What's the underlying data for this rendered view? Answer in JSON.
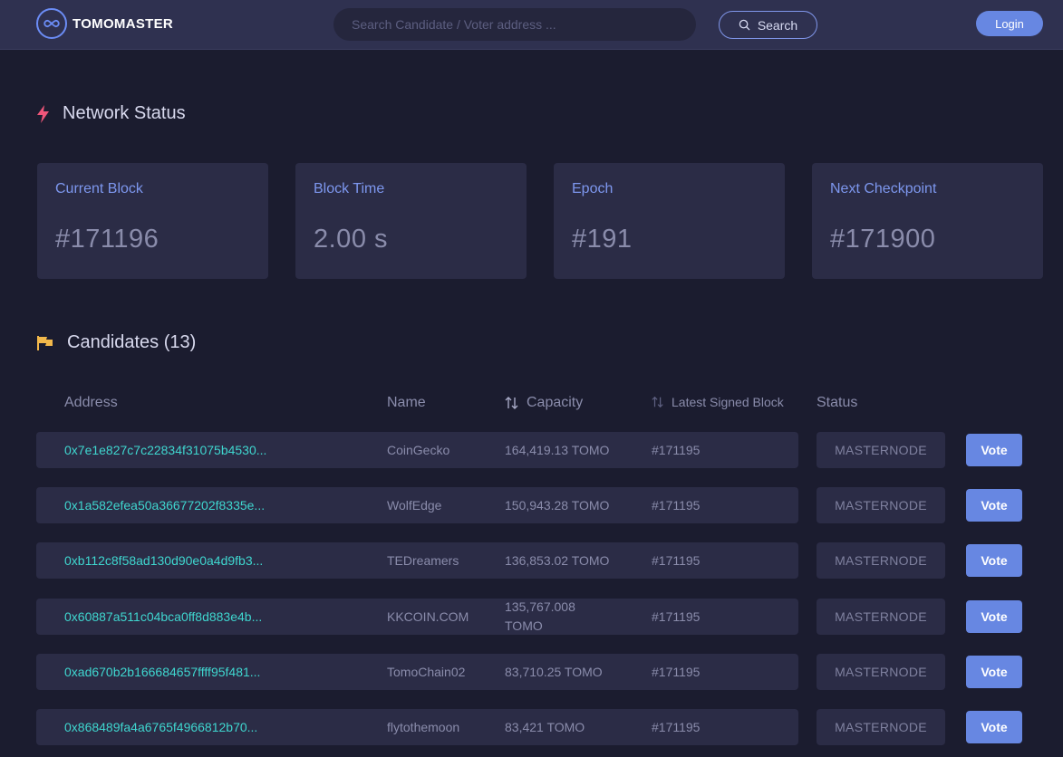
{
  "header": {
    "logo_text": "TOMOMASTER",
    "search_placeholder": "Search Candidate / Voter address ...",
    "search_label": "Search",
    "login_label": "Login"
  },
  "network_status": {
    "title": "Network Status",
    "cards": [
      {
        "label": "Current Block",
        "value": "#171196"
      },
      {
        "label": "Block Time",
        "value": "2.00 s"
      },
      {
        "label": "Epoch",
        "value": "#191"
      },
      {
        "label": "Next Checkpoint",
        "value": "#171900"
      }
    ]
  },
  "candidates": {
    "title": "Candidates (13)",
    "columns": {
      "address": "Address",
      "name": "Name",
      "capacity": "Capacity",
      "latest_signed_block": "Latest Signed Block",
      "status": "Status"
    },
    "vote_label": "Vote",
    "rows": [
      {
        "address": "0x7e1e827c7c22834f31075b4530...",
        "name": "CoinGecko",
        "capacity": "164,419.13 TOMO",
        "block": "#171195",
        "status": "MASTERNODE"
      },
      {
        "address": "0x1a582efea50a36677202f8335e...",
        "name": "WolfEdge",
        "capacity": "150,943.28 TOMO",
        "block": "#171195",
        "status": "MASTERNODE"
      },
      {
        "address": "0xb112c8f58ad130d90e0a4d9fb3...",
        "name": "TEDreamers",
        "capacity": "136,853.02 TOMO",
        "block": "#171195",
        "status": "MASTERNODE"
      },
      {
        "address": "0x60887a511c04bca0ff8d883e4b...",
        "name": "KKCOIN.COM",
        "capacity": "135,767.008 TOMO",
        "block": "#171195",
        "status": "MASTERNODE"
      },
      {
        "address": "0xad670b2b166684657ffff95f481...",
        "name": "TomoChain02",
        "capacity": "83,710.25 TOMO",
        "block": "#171195",
        "status": "MASTERNODE"
      },
      {
        "address": "0x868489fa4a6765f4966812b70...",
        "name": "flytothemoon",
        "capacity": "83,421 TOMO",
        "block": "#171195",
        "status": "MASTERNODE"
      }
    ]
  },
  "colors": {
    "background": "#1b1c2f",
    "topbar": "#2f3150",
    "accent": "#6787e2",
    "address": "#3fd6cf",
    "network_icon": "#f0567a",
    "candidates_icon": "#f2b84b"
  }
}
